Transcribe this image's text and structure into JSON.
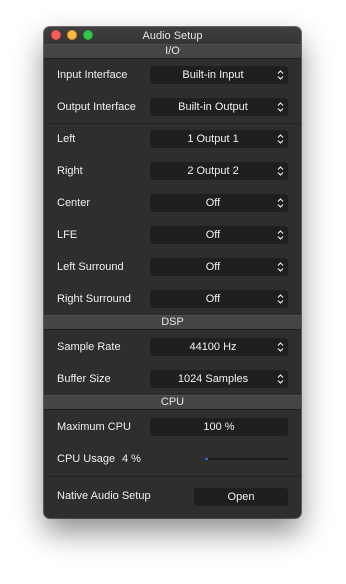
{
  "window": {
    "title": "Audio Setup"
  },
  "sections": {
    "io": "I/O",
    "dsp": "DSP",
    "cpu": "CPU"
  },
  "io": [
    {
      "label": "Input Interface",
      "value": "Built-in Input"
    },
    {
      "label": "Output Interface",
      "value": "Built-in Output"
    },
    {
      "label": "Left",
      "value": "1 Output 1"
    },
    {
      "label": "Right",
      "value": "2 Output 2"
    },
    {
      "label": "Center",
      "value": "Off"
    },
    {
      "label": "LFE",
      "value": "Off"
    },
    {
      "label": "Left Surround",
      "value": "Off"
    },
    {
      "label": "Right Surround",
      "value": "Off"
    }
  ],
  "dsp": [
    {
      "label": "Sample Rate",
      "value": "44100 Hz"
    },
    {
      "label": "Buffer Size",
      "value": "1024 Samples"
    }
  ],
  "cpu": {
    "max_label": "Maximum CPU",
    "max_value": "100 %",
    "usage_label": "CPU Usage",
    "usage_value": "4 %",
    "usage_fraction": 0.04
  },
  "native": {
    "label": "Native Audio Setup",
    "button": "Open"
  },
  "colors": {
    "accent": "#2f74e8",
    "background": "#2e2e2e",
    "control": "#1f1f1f"
  }
}
